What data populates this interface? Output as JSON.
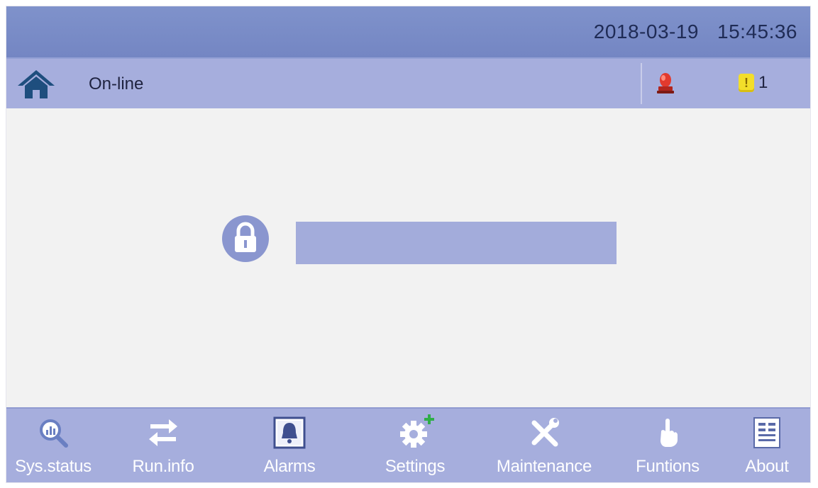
{
  "header": {
    "date": "2018-03-19",
    "time": "15:45:36"
  },
  "statusbar": {
    "status": "On-line",
    "warning_badge": "!",
    "warning_count": "1"
  },
  "login": {
    "password_value": "",
    "lock_icon": "lock-icon"
  },
  "nav": {
    "items": [
      {
        "label": "Sys.status",
        "icon": "sys-status-icon"
      },
      {
        "label": "Run.info",
        "icon": "transfer-arrows-icon"
      },
      {
        "label": "Alarms",
        "icon": "alarm-bell-icon"
      },
      {
        "label": "Settings",
        "icon": "gear-plus-icon"
      },
      {
        "label": "Maintenance",
        "icon": "tools-icon"
      },
      {
        "label": "Funtions",
        "icon": "hand-pointer-icon"
      },
      {
        "label": "About",
        "icon": "document-icon"
      }
    ]
  },
  "colors": {
    "topbar": "#7f92cb",
    "bars": "#a6aedd",
    "content": "#f2f2f2",
    "icon_dark": "#1e4e7e",
    "icon_blue": "#6a7fc2"
  }
}
